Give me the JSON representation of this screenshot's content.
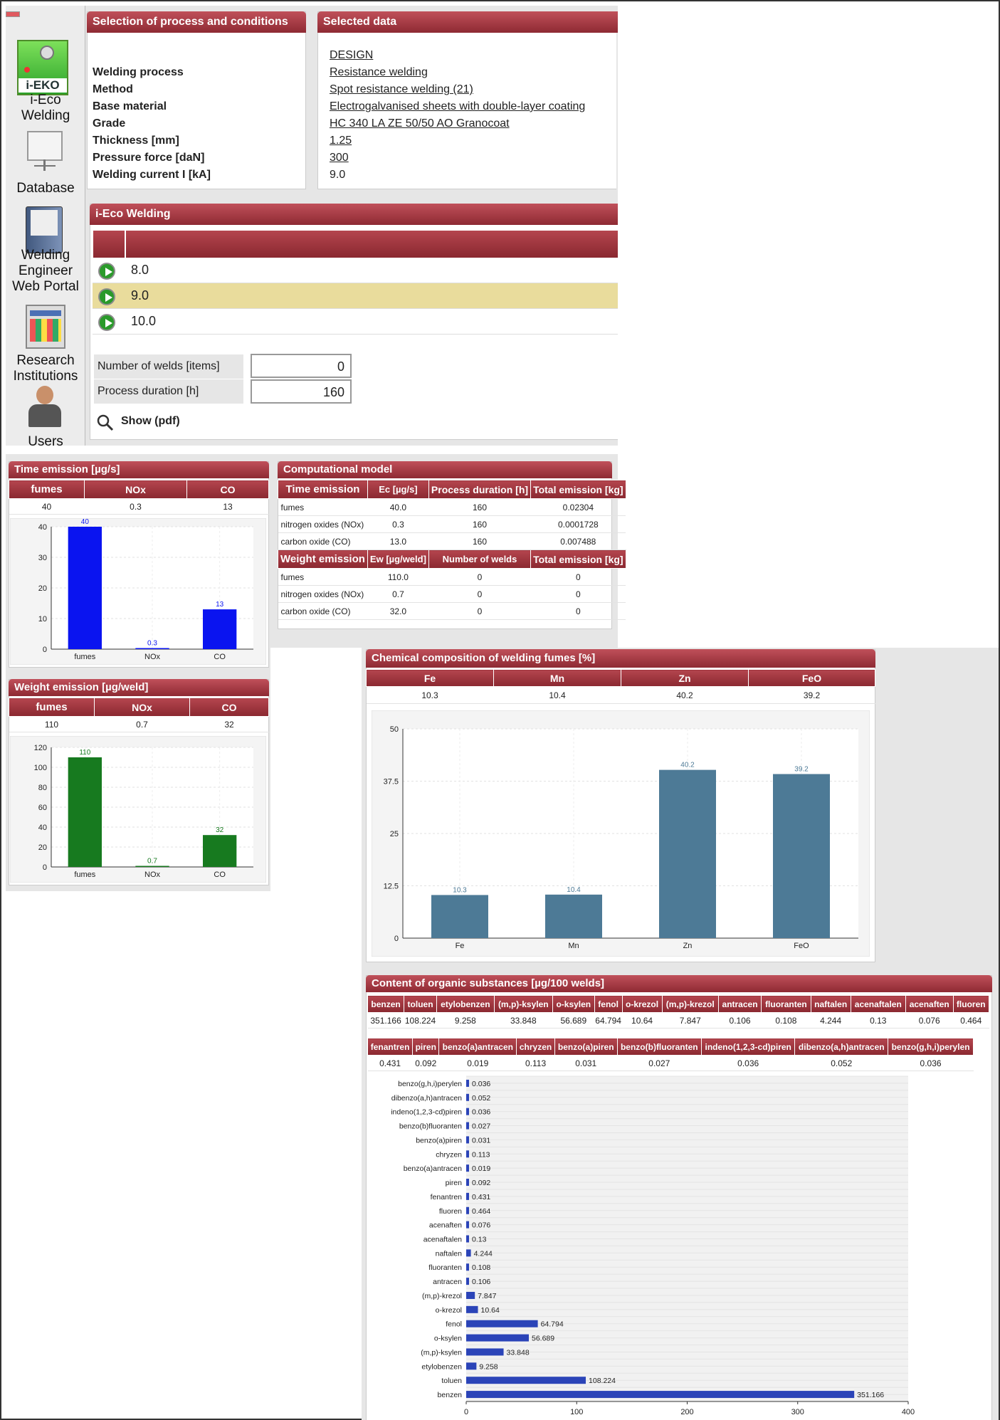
{
  "sidebar": {
    "items": [
      {
        "label": "i-Eco Welding",
        "icon": "i-eko-logo-icon",
        "logo_text": "i-EKO"
      },
      {
        "label": "Database",
        "icon": "presentation-board-icon"
      },
      {
        "label": "Welding Engineer Web Portal",
        "icon": "document-icon"
      },
      {
        "label": "Research Institutions",
        "icon": "calendar-grid-icon"
      },
      {
        "label": "Users",
        "icon": "user-icon"
      }
    ]
  },
  "selection": {
    "title": "Selection of process and conditions",
    "labels": [
      "Welding process",
      "Method",
      "Base material",
      "Grade",
      "Thickness [mm]",
      "Pressure force [daN]",
      "Welding current I [kA]"
    ]
  },
  "selected": {
    "title": "Selected data",
    "values": [
      "DESIGN",
      "Resistance welding",
      "Spot resistance welding (21)",
      "Electrogalvanised sheets with double-layer coating",
      "HC 340 LA ZE 50/50 AO Granocoat",
      "1.25",
      "300",
      "9.0"
    ]
  },
  "ieco": {
    "title": "i-Eco Welding",
    "options": [
      "8.0",
      "9.0",
      "10.0"
    ],
    "selected_option": "9.0",
    "welds_label": "Number of welds [items]",
    "welds_value": "0",
    "duration_label": "Process duration [h]",
    "duration_value": "160",
    "show_label": "Show (pdf)"
  },
  "time_emission": {
    "title": "Time emission [µg/s]",
    "headers": [
      "fumes",
      "NOx",
      "CO"
    ],
    "values": [
      "40",
      "0.3",
      "13"
    ]
  },
  "weight_emission": {
    "title": "Weight emission [µg/weld]",
    "headers": [
      "fumes",
      "NOx",
      "CO"
    ],
    "values": [
      "110",
      "0.7",
      "32"
    ]
  },
  "model": {
    "title": "Computational model",
    "time_headers": [
      "Time emission",
      "Ec [µg/s]",
      "Process duration [h]",
      "Total emission [kg]"
    ],
    "time_rows": [
      [
        "fumes",
        "40.0",
        "160",
        "0.02304"
      ],
      [
        "nitrogen oxides (NOx)",
        "0.3",
        "160",
        "0.0001728"
      ],
      [
        "carbon oxide (CO)",
        "13.0",
        "160",
        "0.007488"
      ]
    ],
    "weight_headers": [
      "Weight emission",
      "Ew [µg/weld]",
      "Number of welds",
      "Total emission [kg]"
    ],
    "weight_rows": [
      [
        "fumes",
        "110.0",
        "0",
        "0"
      ],
      [
        "nitrogen oxides (NOx)",
        "0.7",
        "0",
        "0"
      ],
      [
        "carbon oxide (CO)",
        "32.0",
        "0",
        "0"
      ]
    ]
  },
  "chem": {
    "title": "Chemical composition of welding fumes [%]",
    "headers": [
      "Fe",
      "Mn",
      "Zn",
      "FeO"
    ],
    "values": [
      "10.3",
      "10.4",
      "40.2",
      "39.2"
    ]
  },
  "organic": {
    "title": "Content of organic substances [µg/100 welds]",
    "headers1": [
      "benzen",
      "toluen",
      "etylobenzen",
      "(m,p)-ksylen",
      "o-ksylen",
      "fenol",
      "o-krezol",
      "(m,p)-krezol",
      "antracen",
      "fluoranten",
      "naftalen",
      "acenaftalen",
      "acenaften",
      "fluoren"
    ],
    "values1": [
      "351.166",
      "108.224",
      "9.258",
      "33.848",
      "56.689",
      "64.794",
      "10.64",
      "7.847",
      "0.106",
      "0.108",
      "4.244",
      "0.13",
      "0.076",
      "0.464"
    ],
    "headers2": [
      "fenantren",
      "piren",
      "benzo(a)antracen",
      "chryzen",
      "benzo(a)piren",
      "benzo(b)fluoranten",
      "indeno(1,2,3-cd)piren",
      "dibenzo(a,h)antracen",
      "benzo(g,h,i)perylen"
    ],
    "values2": [
      "0.431",
      "0.092",
      "0.019",
      "0.113",
      "0.031",
      "0.027",
      "0.036",
      "0.052",
      "0.036"
    ]
  },
  "chart_data": [
    {
      "type": "bar",
      "categories": [
        "fumes",
        "NOx",
        "CO"
      ],
      "values": [
        40,
        0.3,
        13
      ],
      "ylim": [
        0,
        40
      ],
      "yticks": [
        0,
        10,
        20,
        30,
        40
      ],
      "color": "#0a14f0",
      "labels": [
        "40",
        "0.3",
        "13"
      ]
    },
    {
      "type": "bar",
      "categories": [
        "fumes",
        "NOx",
        "CO"
      ],
      "values": [
        110,
        0.7,
        32
      ],
      "ylim": [
        0,
        120
      ],
      "yticks": [
        0,
        20,
        40,
        60,
        80,
        100,
        120
      ],
      "color": "#177a1f",
      "labels": [
        "110",
        "0.7",
        "32"
      ]
    },
    {
      "type": "bar",
      "categories": [
        "Fe",
        "Mn",
        "Zn",
        "FeO"
      ],
      "values": [
        10.3,
        10.4,
        40.2,
        39.2
      ],
      "ylim": [
        0,
        50
      ],
      "yticks": [
        "0",
        "12.5",
        "25",
        "37.5",
        "50"
      ],
      "color": "#4d7a96",
      "labels": [
        "10.3",
        "10.4",
        "40.2",
        "39.2"
      ]
    },
    {
      "type": "bar",
      "orientation": "horizontal",
      "categories": [
        "benzo(g,h,i)perylen",
        "dibenzo(a,h)antracen",
        "indeno(1,2,3-cd)piren",
        "benzo(b)fluoranten",
        "benzo(a)piren",
        "chryzen",
        "benzo(a)antracen",
        "piren",
        "fenantren",
        "fluoren",
        "acenaften",
        "acenaftalen",
        "naftalen",
        "fluoranten",
        "antracen",
        "(m,p)-krezol",
        "o-krezol",
        "fenol",
        "o-ksylen",
        "(m,p)-ksylen",
        "etylobenzen",
        "toluen",
        "benzen"
      ],
      "values": [
        0.036,
        0.052,
        0.036,
        0.027,
        0.031,
        0.113,
        0.019,
        0.092,
        0.431,
        0.464,
        0.076,
        0.13,
        4.244,
        0.108,
        0.106,
        7.847,
        10.64,
        64.794,
        56.689,
        33.848,
        9.258,
        108.224,
        351.166
      ],
      "labels": [
        "0.036",
        "0.052",
        "0.036",
        "0.027",
        "0.031",
        "0.113",
        "0.019",
        "0.092",
        "0.431",
        "0.464",
        "0.076",
        "0.13",
        "4.244",
        "0.108",
        "0.106",
        "7.847",
        "10.64",
        "64.794",
        "56.689",
        "33.848",
        "9.258",
        "108.224",
        "351.166"
      ],
      "xlim": [
        0,
        400
      ],
      "xticks": [
        0,
        100,
        200,
        300,
        400
      ],
      "color": "#2b44b8"
    }
  ],
  "colors": {
    "header": "#9a3039",
    "highlight": "#e9dc9c"
  }
}
